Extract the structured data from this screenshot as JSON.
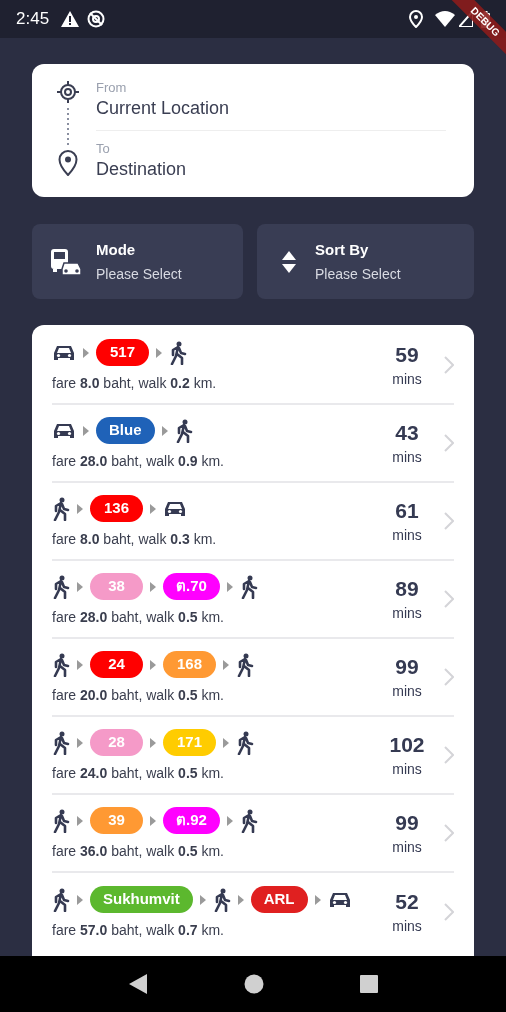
{
  "status_bar": {
    "time": "2:45"
  },
  "debug_banner": "DEBUG",
  "route": {
    "from_label": "From",
    "from_value": "Current Location",
    "to_label": "To",
    "to_value": "Destination"
  },
  "filters": [
    {
      "kind": "mode",
      "title": "Mode",
      "value": "Please Select"
    },
    {
      "kind": "sort",
      "title": "Sort By",
      "value": "Please Select"
    }
  ],
  "results": [
    {
      "segments": [
        {
          "kind": "car"
        },
        {
          "kind": "line",
          "label": "517",
          "color": "#ff0000"
        },
        {
          "kind": "walk"
        }
      ],
      "summary": "fare **8.0** baht, walk **0.2** km.",
      "duration": "59",
      "unit": "mins"
    },
    {
      "segments": [
        {
          "kind": "car"
        },
        {
          "kind": "line",
          "label": "Blue",
          "color": "#1f62b8"
        },
        {
          "kind": "walk"
        }
      ],
      "summary": "fare **28.0** baht, walk **0.9** km.",
      "duration": "43",
      "unit": "mins"
    },
    {
      "segments": [
        {
          "kind": "walk"
        },
        {
          "kind": "line",
          "label": "136",
          "color": "#ff0000"
        },
        {
          "kind": "car"
        }
      ],
      "summary": "fare **8.0** baht, walk **0.3** km.",
      "duration": "61",
      "unit": "mins"
    },
    {
      "segments": [
        {
          "kind": "walk"
        },
        {
          "kind": "line",
          "label": "38",
          "color": "#f59ac8"
        },
        {
          "kind": "line",
          "label": "ต.70",
          "color": "#ff00ff"
        },
        {
          "kind": "walk"
        }
      ],
      "summary": "fare **28.0** baht, walk **0.5** km.",
      "duration": "89",
      "unit": "mins"
    },
    {
      "segments": [
        {
          "kind": "walk"
        },
        {
          "kind": "line",
          "label": "24",
          "color": "#ff0000"
        },
        {
          "kind": "line",
          "label": "168",
          "color": "#ff9933"
        },
        {
          "kind": "walk"
        }
      ],
      "summary": "fare **20.0** baht, walk **0.5** km.",
      "duration": "99",
      "unit": "mins"
    },
    {
      "segments": [
        {
          "kind": "walk"
        },
        {
          "kind": "line",
          "label": "28",
          "color": "#f59ac8"
        },
        {
          "kind": "line",
          "label": "171",
          "color": "#ffcc00"
        },
        {
          "kind": "walk"
        }
      ],
      "summary": "fare **24.0** baht, walk **0.5** km.",
      "duration": "102",
      "unit": "mins"
    },
    {
      "segments": [
        {
          "kind": "walk"
        },
        {
          "kind": "line",
          "label": "39",
          "color": "#ff9933"
        },
        {
          "kind": "line",
          "label": "ต.92",
          "color": "#ff00ff"
        },
        {
          "kind": "walk"
        }
      ],
      "summary": "fare **36.0** baht, walk **0.5** km.",
      "duration": "99",
      "unit": "mins"
    },
    {
      "segments": [
        {
          "kind": "walk"
        },
        {
          "kind": "line",
          "label": "Sukhumvit",
          "color": "#5cb82e"
        },
        {
          "kind": "walk"
        },
        {
          "kind": "line",
          "label": "ARL",
          "color": "#e02020"
        },
        {
          "kind": "car"
        }
      ],
      "summary": "fare **57.0** baht, walk **0.7** km.",
      "duration": "52",
      "unit": "mins"
    }
  ]
}
